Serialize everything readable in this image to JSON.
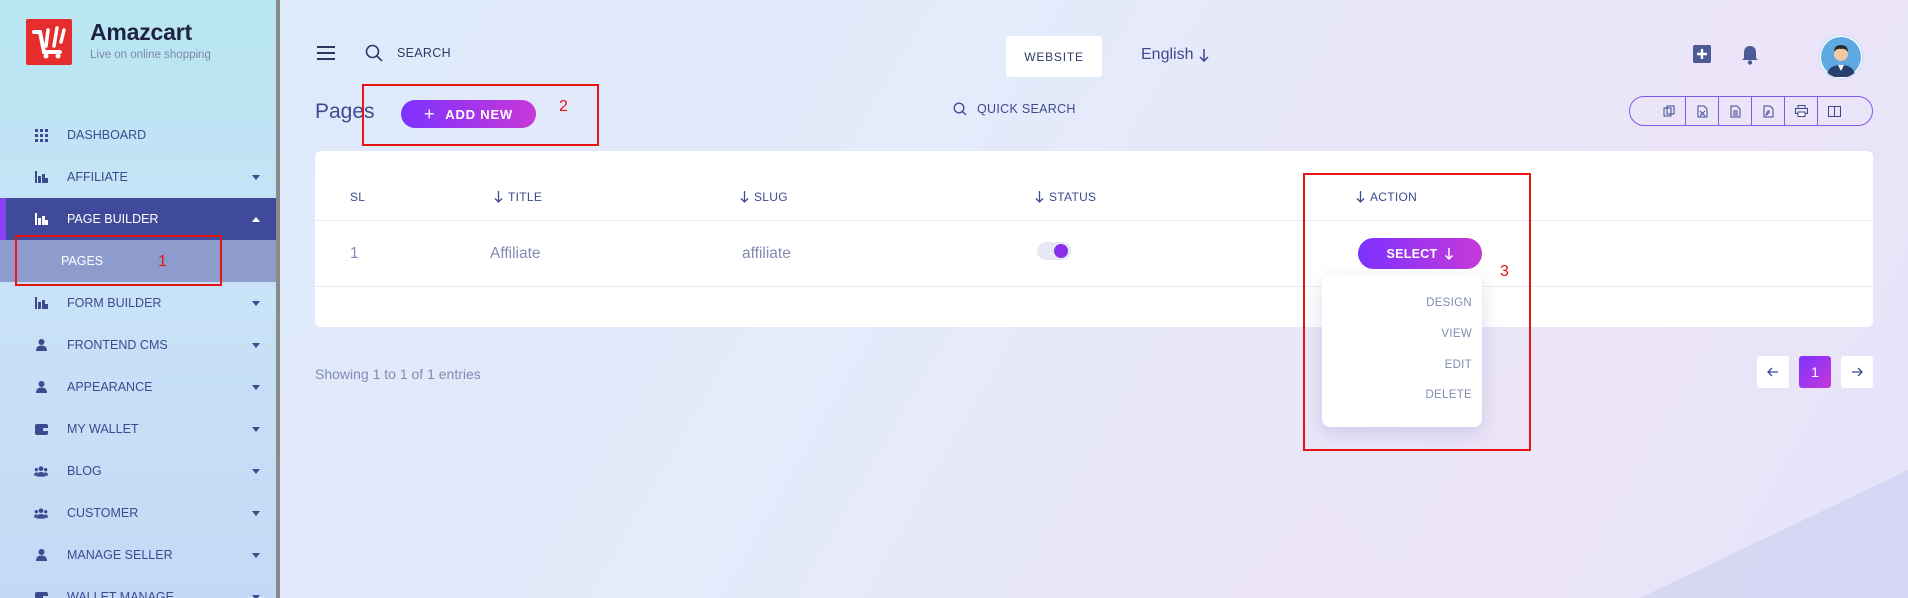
{
  "brand": {
    "name": "Amazcart",
    "tagline": "Live on online shopping"
  },
  "sidebar": {
    "items": [
      {
        "label": "DASHBOARD",
        "icon": "grid-icon",
        "dropdown": false
      },
      {
        "label": "AFFILIATE",
        "icon": "chart-icon",
        "dropdown": true
      },
      {
        "label": "PAGE BUILDER",
        "icon": "chart-icon",
        "dropdown": true,
        "active": true
      },
      {
        "label": "PAGES",
        "sub": true
      },
      {
        "label": "FORM BUILDER",
        "icon": "chart-icon",
        "dropdown": true
      },
      {
        "label": "FRONTEND CMS",
        "icon": "user-icon",
        "dropdown": true
      },
      {
        "label": "APPEARANCE",
        "icon": "user-icon",
        "dropdown": true
      },
      {
        "label": "MY WALLET",
        "icon": "wallet-icon",
        "dropdown": true
      },
      {
        "label": "BLOG",
        "icon": "users-icon",
        "dropdown": true
      },
      {
        "label": "CUSTOMER",
        "icon": "users-icon",
        "dropdown": true
      },
      {
        "label": "MANAGE SELLER",
        "icon": "user-icon",
        "dropdown": true
      },
      {
        "label": "WALLET MANAGE",
        "icon": "wallet-icon",
        "dropdown": true
      }
    ]
  },
  "header": {
    "search_label": "SEARCH",
    "website_button": "WEBSITE",
    "language": "English"
  },
  "page": {
    "title": "Pages",
    "add_new": "ADD NEW",
    "quick_search": "QUICK SEARCH"
  },
  "table": {
    "columns": [
      "SL",
      "TITLE",
      "SLUG",
      "STATUS",
      "ACTION"
    ],
    "rows": [
      {
        "sl": "1",
        "title": "Affiliate",
        "slug": "affiliate",
        "status": true,
        "action": "SELECT"
      }
    ]
  },
  "dropdown": {
    "items": [
      "DESIGN",
      "VIEW",
      "EDIT",
      "DELETE"
    ]
  },
  "footer": {
    "showing": "Showing 1 to 1 of 1 entries",
    "current_page": "1"
  },
  "annotations": {
    "one": "1",
    "two": "2",
    "three": "3"
  },
  "colors": {
    "accent": "#7c32ff",
    "accent2": "#c738d8",
    "sidebar_active": "#3f4a9a",
    "annotation": "#e81414"
  }
}
